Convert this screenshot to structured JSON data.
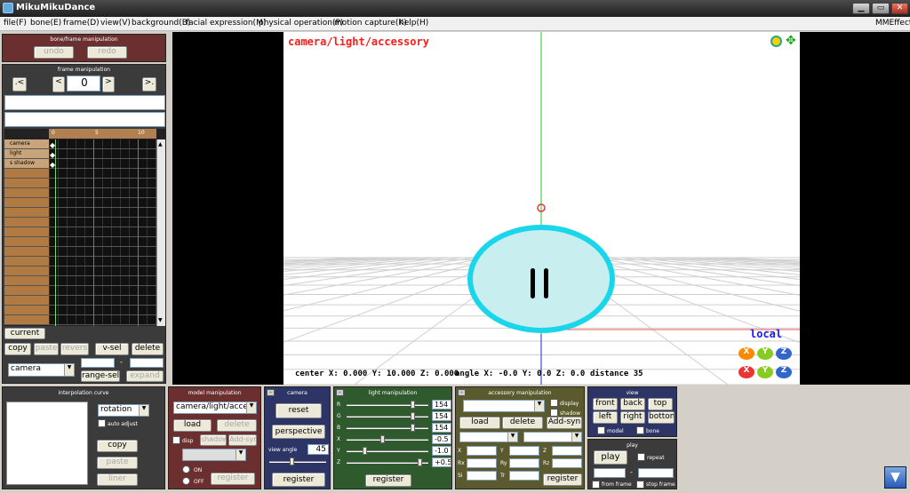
{
  "window": {
    "title": "MikuMikuDance"
  },
  "menu": [
    "file(F)",
    "bone(E)",
    "frame(D)",
    "view(V)",
    "background(B)",
    "facial expression(M)",
    "physical operation(P)",
    "motion capture(K)",
    "help(H)"
  ],
  "mmeffect": "MMEffect",
  "bone_frame": {
    "title": "bone/frame manipulation",
    "undo": "undo",
    "redo": "redo"
  },
  "frame_manip": {
    "title": "frame manipulation",
    "frame": "0",
    "prev_key": ".<",
    "prev": "<",
    "next": ">",
    "next_key": ">."
  },
  "timeline": {
    "ticks": [
      "0",
      "5",
      "10"
    ],
    "rows": [
      "camera",
      "light",
      "s shadow"
    ]
  },
  "timeline_btns": {
    "current": "current",
    "copy": "copy",
    "paste": "paste",
    "revers": "revers",
    "vsel": "v-sel",
    "delete": "delete",
    "model": "camera",
    "range_sel": "range-sel",
    "expand": "expand"
  },
  "viewport": {
    "label": "camera/light/accessory",
    "local": "local",
    "status_center": "center  X: 0.000  Y: 10.000  Z: 0.000",
    "status_angle": "angle  X: -0.0  Y:  0.0  Z:  0.0",
    "status_distance": "distance  35"
  },
  "interp": {
    "title": "interpolation curve",
    "select": "rotation",
    "auto_adjust": "auto adjust",
    "copy": "copy",
    "paste": "paste",
    "liner": "liner"
  },
  "model_manip": {
    "title": "model manipulation",
    "select": "camera/light/accessory",
    "load": "load",
    "delete": "delete",
    "disp": "disp",
    "shadow": "shadow",
    "addsyn": "Add-syn",
    "on": "ON",
    "off": "OFF",
    "register": "register"
  },
  "camera": {
    "title": "camera",
    "reset": "reset",
    "perspective": "perspective",
    "view_angle_label": "view angle",
    "view_angle": "45",
    "register": "register"
  },
  "light": {
    "title": "light manipulation",
    "rows": [
      {
        "l": "R",
        "v": "154"
      },
      {
        "l": "G",
        "v": "154"
      },
      {
        "l": "B",
        "v": "154"
      },
      {
        "l": "X",
        "v": "-0.5"
      },
      {
        "l": "Y",
        "v": "-1.0"
      },
      {
        "l": "Z",
        "v": "+0.5"
      }
    ],
    "register": "register"
  },
  "accessory": {
    "title": "accessory manipulation",
    "display": "display",
    "shadow": "shadow",
    "load": "load",
    "delete": "delete",
    "addsyn": "Add-syn",
    "fields": [
      "X",
      "Y",
      "Z",
      "Rx",
      "Ry",
      "Rz",
      "Si",
      "Tr"
    ],
    "register": "register"
  },
  "view": {
    "title": "view",
    "front": "front",
    "back": "back",
    "top": "top",
    "left": "left",
    "right": "right",
    "bottom": "bottom",
    "model": "model",
    "bone": "bone"
  },
  "play": {
    "title": "play",
    "play": "play",
    "repeat": "repeat",
    "from_frame": "from frame",
    "stop_frame": "stop frame"
  },
  "colors": {
    "bone_panel": "#6b2f2f",
    "frame_panel": "#3b3b3b",
    "interp_panel": "#3b3b3b",
    "model_panel": "#6b2f2f",
    "camera_panel": "#2d3566",
    "light_panel": "#2e5a2e",
    "accessory_panel": "#5a5a2e",
    "view_panel": "#2d3566",
    "play_panel": "#3b3b3b",
    "viewport_label": "#ff1a1a",
    "local_label": "#1a1ae6"
  }
}
